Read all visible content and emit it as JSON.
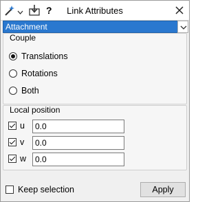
{
  "window": {
    "title": "Link Attributes",
    "help_label": "?"
  },
  "toolbar": {
    "icons": [
      "magic-wand-icon",
      "chevron-down-icon",
      "dock-arrow-icon",
      "help-icon",
      "close-icon"
    ]
  },
  "attachment": {
    "selected": "Attachment"
  },
  "couple": {
    "legend": "Couple",
    "options": [
      {
        "label": "Translations",
        "selected": true
      },
      {
        "label": "Rotations",
        "selected": false
      },
      {
        "label": "Both",
        "selected": false
      }
    ]
  },
  "local_position": {
    "legend": "Local position",
    "axes": [
      {
        "label": "u",
        "checked": true,
        "value": "0.0"
      },
      {
        "label": "v",
        "checked": true,
        "value": "0.0"
      },
      {
        "label": "w",
        "checked": true,
        "value": "0.0"
      }
    ]
  },
  "footer": {
    "keep_selection_label": "Keep selection",
    "keep_selection_checked": false,
    "apply_label": "Apply"
  },
  "colors": {
    "dropdown_bg": "#2a78cf",
    "window_bg": "#f0f0f0"
  }
}
